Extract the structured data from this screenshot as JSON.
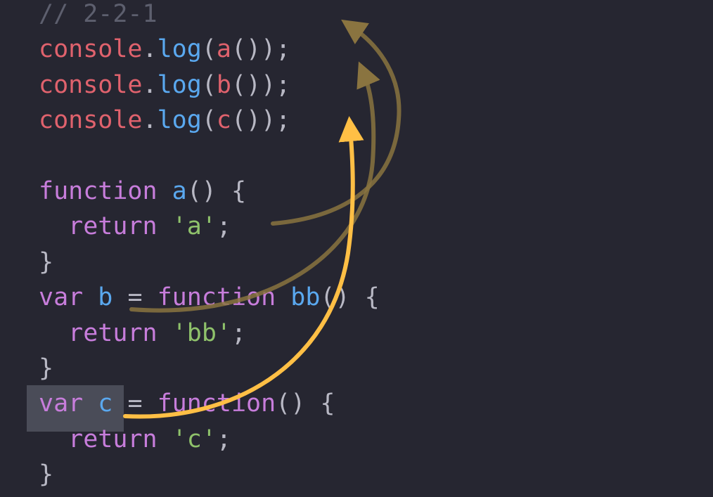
{
  "code_lines": [
    [
      {
        "t": "// 2-2-1",
        "k": "comment"
      }
    ],
    [
      {
        "t": "console",
        "k": "object"
      },
      {
        "t": ".",
        "k": "punc"
      },
      {
        "t": "log",
        "k": "method"
      },
      {
        "t": "(",
        "k": "punc"
      },
      {
        "t": "a",
        "k": "object"
      },
      {
        "t": "());",
        "k": "punc"
      }
    ],
    [
      {
        "t": "console",
        "k": "object"
      },
      {
        "t": ".",
        "k": "punc"
      },
      {
        "t": "log",
        "k": "method"
      },
      {
        "t": "(",
        "k": "punc"
      },
      {
        "t": "b",
        "k": "object"
      },
      {
        "t": "());",
        "k": "punc"
      }
    ],
    [
      {
        "t": "console",
        "k": "object"
      },
      {
        "t": ".",
        "k": "punc"
      },
      {
        "t": "log",
        "k": "method"
      },
      {
        "t": "(",
        "k": "punc"
      },
      {
        "t": "c",
        "k": "object"
      },
      {
        "t": "());",
        "k": "punc"
      }
    ],
    [],
    [
      {
        "t": "function",
        "k": "kw"
      },
      {
        "t": " ",
        "k": "punc"
      },
      {
        "t": "a",
        "k": "fn"
      },
      {
        "t": "() {",
        "k": "punc"
      }
    ],
    [
      {
        "t": "  ",
        "k": "punc"
      },
      {
        "t": "return",
        "k": "kw"
      },
      {
        "t": " ",
        "k": "punc"
      },
      {
        "t": "'a'",
        "k": "str"
      },
      {
        "t": ";",
        "k": "punc"
      }
    ],
    [
      {
        "t": "}",
        "k": "punc"
      }
    ],
    [
      {
        "t": "var",
        "k": "kw"
      },
      {
        "t": " ",
        "k": "punc"
      },
      {
        "t": "b",
        "k": "fn"
      },
      {
        "t": " = ",
        "k": "punc"
      },
      {
        "t": "function",
        "k": "kw"
      },
      {
        "t": " ",
        "k": "punc"
      },
      {
        "t": "bb",
        "k": "fn"
      },
      {
        "t": "() {",
        "k": "punc"
      }
    ],
    [
      {
        "t": "  ",
        "k": "punc"
      },
      {
        "t": "return",
        "k": "kw"
      },
      {
        "t": " ",
        "k": "punc"
      },
      {
        "t": "'bb'",
        "k": "str"
      },
      {
        "t": ";",
        "k": "punc"
      }
    ],
    [
      {
        "t": "}",
        "k": "punc"
      }
    ],
    [
      {
        "t": "var",
        "k": "kw"
      },
      {
        "t": " ",
        "k": "punc"
      },
      {
        "t": "c",
        "k": "fn"
      },
      {
        "t": " = ",
        "k": "punc"
      },
      {
        "t": "function",
        "k": "kw"
      },
      {
        "t": "() {",
        "k": "punc"
      }
    ],
    [
      {
        "t": "  ",
        "k": "punc"
      },
      {
        "t": "return",
        "k": "kw"
      },
      {
        "t": " ",
        "k": "punc"
      },
      {
        "t": "'c'",
        "k": "str"
      },
      {
        "t": ";",
        "k": "punc"
      }
    ],
    [
      {
        "t": "}",
        "k": "punc"
      }
    ]
  ],
  "colors": {
    "background": "#262631",
    "comment": "#5d5f6e",
    "object": "#e0626d",
    "method": "#5aa8ef",
    "keyword": "#c77ddb",
    "string": "#8fc26b",
    "punctuation": "#b8b8c4",
    "selection": "#4a4c58",
    "arrow_active": "#ffbf45",
    "arrow_dim": "#8a7440"
  }
}
